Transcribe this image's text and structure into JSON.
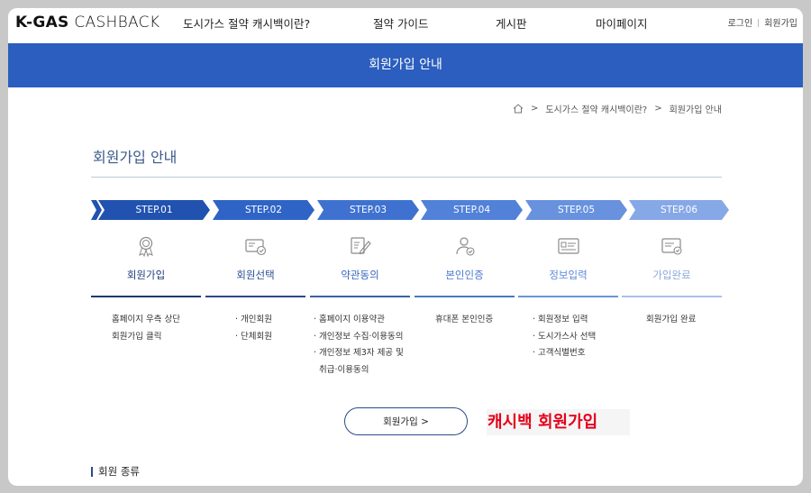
{
  "header": {
    "logo_bold": "K-GAS",
    "logo_light": " CASHBACK",
    "nav": [
      "도시가스 절약 캐시백이란?",
      "절약 가이드",
      "게시판",
      "마이페이지"
    ],
    "login": "로그인",
    "signup": "회원가입"
  },
  "banner": {
    "title": "회원가입 안내"
  },
  "breadcrumb": {
    "parent": "도시가스 절약 캐시백이란?",
    "current": "회원가입 안내",
    "sep": ">"
  },
  "page": {
    "title": "회원가입 안내"
  },
  "steps": [
    {
      "step": "STEP.01",
      "title": "회원가입",
      "color": "#2152b0",
      "desc": [
        "홈페이지 우측 상단",
        "회원가입 클릭"
      ]
    },
    {
      "step": "STEP.02",
      "title": "회원선택",
      "color": "#2f64c6",
      "desc": [
        "· 개인회원",
        "· 단체회원"
      ]
    },
    {
      "step": "STEP.03",
      "title": "약관동의",
      "color": "#3f72d0",
      "desc": [
        "· 홈페이지 이용약관",
        "· 개인정보 수집·이용동의",
        "· 개인정보 제3자 제공 및",
        "  취급·이용동의"
      ]
    },
    {
      "step": "STEP.04",
      "title": "본인인증",
      "color": "#5181d8",
      "desc": [
        "휴대폰 본인인증"
      ]
    },
    {
      "step": "STEP.05",
      "title": "정보입력",
      "color": "#6892de",
      "desc": [
        "· 회원정보 입력",
        "· 도시가스사 선택",
        "· 고객식별번호"
      ]
    },
    {
      "step": "STEP.06",
      "title": "가입완료",
      "color": "#86a8e6",
      "desc": [
        "회원가입 완료"
      ]
    }
  ],
  "cta": {
    "label": "회원가입 >",
    "overlay": "캐시백 회원가입"
  },
  "section": {
    "title": "회원 종류"
  }
}
